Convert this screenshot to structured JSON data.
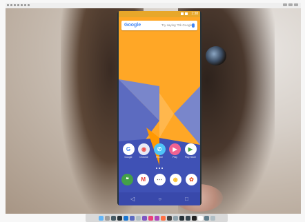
{
  "menubar": {
    "icons": [
      "apple-icon",
      "app-menu",
      "file-menu",
      "edit-menu",
      "view-menu",
      "window-menu",
      "help-menu"
    ]
  },
  "statusbar": {
    "time": "1:38"
  },
  "search": {
    "logo": "Google",
    "hint": "Try saying \"Ok Google\""
  },
  "apps": [
    {
      "name": "google-app",
      "glyph": "G",
      "label": "Google",
      "color": "#ffffff",
      "text": "#4285f4"
    },
    {
      "name": "chrome-app",
      "glyph": "◉",
      "label": "Chrome",
      "color": "#e8eaf6",
      "text": "#ef5350"
    },
    {
      "name": "phone-app",
      "glyph": "✆",
      "label": "Phone",
      "color": "#4fc3f7",
      "text": "#ffffff"
    },
    {
      "name": "play-app",
      "glyph": "▶",
      "label": "Play",
      "color": "#f06292",
      "text": "#ffffff"
    },
    {
      "name": "play-store-app",
      "glyph": "▶",
      "label": "Play Store",
      "color": "#ffffff",
      "text": "#43a047"
    }
  ],
  "hotseat": [
    {
      "name": "hangouts-app",
      "glyph": "❝",
      "color": "#43a047",
      "text": "#ffffff"
    },
    {
      "name": "gmail-app",
      "glyph": "M",
      "color": "#ffffff",
      "text": "#e53935"
    },
    {
      "name": "app-drawer",
      "glyph": "⋯",
      "color": "#ffffff",
      "text": "#555555"
    },
    {
      "name": "chrome-browser",
      "glyph": "◉",
      "color": "#ffffff",
      "text": "#fbc02d"
    },
    {
      "name": "photos-app",
      "glyph": "✿",
      "color": "#ffffff",
      "text": "#e64a19"
    }
  ],
  "navbar": {
    "back": "◁",
    "home": "○",
    "recents": "□"
  },
  "dock_colors": [
    "#64b5f6",
    "#9e9e9e",
    "#455a64",
    "#263238",
    "#1976d2",
    "#5c6bc0",
    "#b0bec5",
    "#7e57c2",
    "#ec407a",
    "#ab47bc",
    "#ff7043",
    "#424242",
    "#90a4ae",
    "#263238",
    "#37474f",
    "#212121",
    "#ffffff",
    "#607d8b",
    "#b0bec5"
  ]
}
